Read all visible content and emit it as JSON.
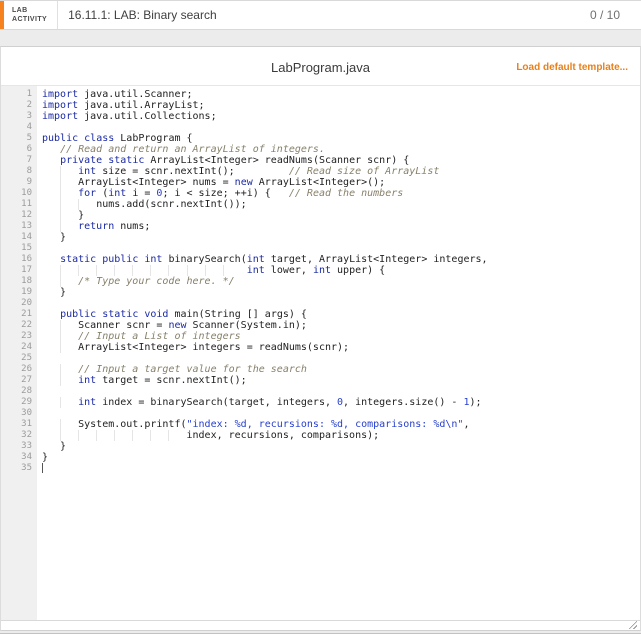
{
  "activity_bar": {
    "kicker_line1": "LAB",
    "kicker_line2": "ACTIVITY",
    "title": "16.11.1: LAB: Binary search",
    "score": "0 / 10",
    "accent_color": "#f5821f"
  },
  "editor": {
    "filename": "LabProgram.java",
    "load_template_label": "Load default template...",
    "link_color": "#e8801a",
    "line_count": 35,
    "code_lines": [
      "import java.util.Scanner;",
      "import java.util.ArrayList;",
      "import java.util.Collections;",
      "",
      "public class LabProgram {",
      "   // Read and return an ArrayList of integers.",
      "   private static ArrayList<Integer> readNums(Scanner scnr) {",
      "      int size = scnr.nextInt();         // Read size of ArrayList",
      "      ArrayList<Integer> nums = new ArrayList<Integer>();",
      "      for (int i = 0; i < size; ++i) {   // Read the numbers",
      "         nums.add(scnr.nextInt());",
      "      }",
      "      return nums;",
      "   }",
      "",
      "   static public int binarySearch(int target, ArrayList<Integer> integers,",
      "                                  int lower, int upper) {",
      "      /* Type your code here. */",
      "   }",
      "",
      "   public static void main(String [] args) {",
      "      Scanner scnr = new Scanner(System.in);",
      "      // Input a List of integers",
      "      ArrayList<Integer> integers = readNums(scnr);",
      "",
      "      // Input a target value for the search",
      "      int target = scnr.nextInt();",
      "",
      "      int index = binarySearch(target, integers, 0, integers.size() - 1);",
      "",
      "      System.out.printf(\"index: %d, recursions: %d, comparisons: %d\\n\",",
      "                        index, recursions, comparisons);",
      "   }",
      "}",
      ""
    ]
  },
  "syntax_colors": {
    "default": "#222222",
    "keyword": "#1b2aa3",
    "comment": "#87806a",
    "string": "#2840cc",
    "number": "#2840cc"
  }
}
